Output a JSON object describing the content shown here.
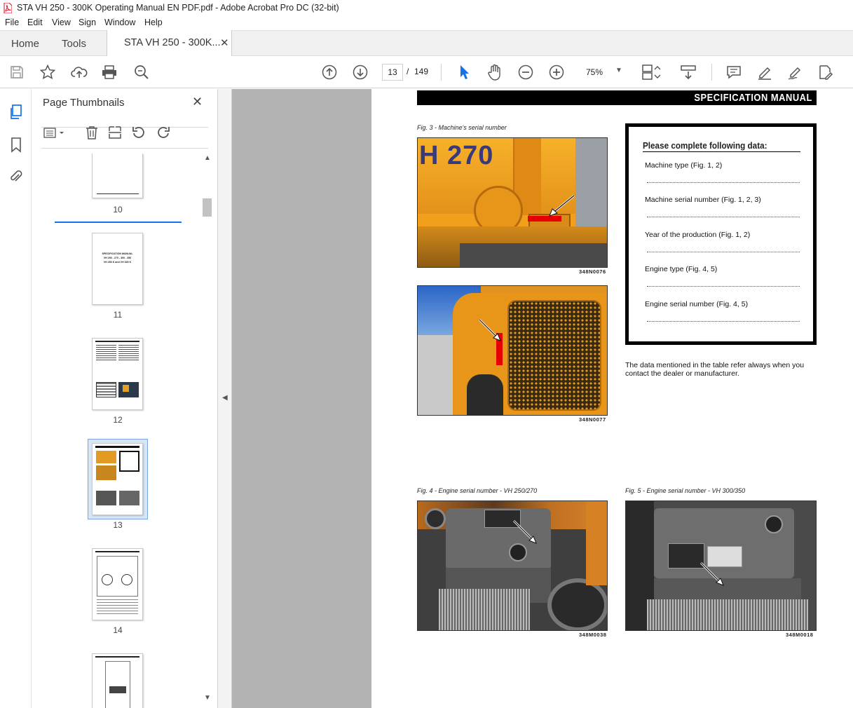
{
  "window": {
    "title": "STA VH 250 - 300K Operating Manual EN PDF.pdf - Adobe Acrobat Pro DC (32-bit)"
  },
  "menu": [
    "File",
    "Edit",
    "View",
    "Sign",
    "Window",
    "Help"
  ],
  "tabs": {
    "home": "Home",
    "tools": "Tools",
    "document": "STA VH 250 - 300K..."
  },
  "toolbar": {
    "page_current": "13",
    "page_sep": "/",
    "page_total": "149",
    "zoom": "75%"
  },
  "thumbnails_panel": {
    "title": "Page Thumbnails",
    "pages": [
      "10",
      "11",
      "12",
      "13",
      "14"
    ],
    "selected_page": "13",
    "page11_lines": [
      "SPECIFICATION MANUAL",
      "VH 250 - 270 - 300 - 350",
      "VH 250 K and VH 300 K"
    ]
  },
  "document": {
    "header": "SPECIFICATION MANUAL",
    "fig3_caption": "Fig. 3 - Machine's serial number",
    "fig3a_code": "348N0076",
    "fig3b_code": "348N0077",
    "fig3_photo_text": "H 270",
    "form": {
      "title": "Please complete following data:",
      "fields": [
        "Machine type (Fig. 1, 2)",
        "Machine serial number (Fig. 1, 2, 3)",
        "Year of the production (Fig. 1, 2)",
        "Engine type (Fig. 4, 5)",
        "Engine serial number (Fig. 4, 5)"
      ]
    },
    "note": "The data mentioned in the table refer always when you contact the dealer or manufacturer.",
    "fig4_caption": "Fig. 4 - Engine serial number - VH 250/270",
    "fig4_code": "348M0038",
    "fig5_caption": "Fig. 5 - Engine serial number - VH 300/350",
    "fig5_code": "348M0018"
  },
  "colors": {
    "accent": "#1473e6",
    "pdf_red": "#e8001c",
    "machine_yellow": "#f2a01c"
  }
}
